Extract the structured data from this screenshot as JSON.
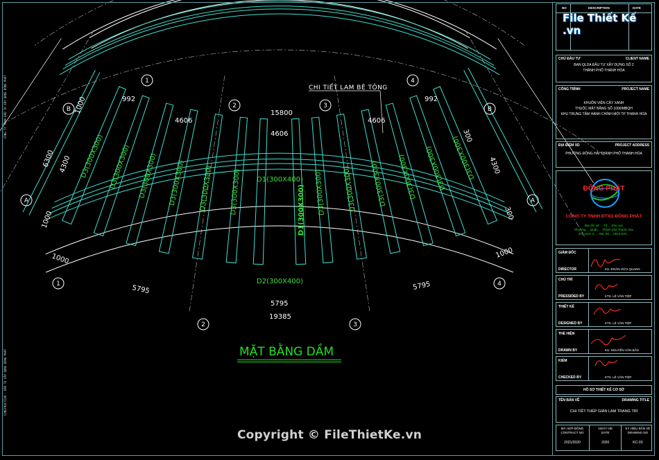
{
  "drawing": {
    "title": "MẶT BẰNG DẦM",
    "callout": "CHI TIẾT LAM BÊ TÔNG",
    "grid_labels": [
      "1",
      "2",
      "3",
      "4",
      "A",
      "B"
    ],
    "dimensions": {
      "d_15800": "15800",
      "d_4606_a": "4606",
      "d_4606_b": "4606",
      "d_4606_c": "4606",
      "d_992_a": "992",
      "d_992_b": "992",
      "d_1000_tl": "1000",
      "d_6300_l": "6300",
      "d_4300_l": "4300",
      "d_1000_l": "1000",
      "d_1000_bl": "1000",
      "d_5795_l": "5795",
      "d_5795_c": "5795",
      "d_5795_r": "5795",
      "d_19385": "19385",
      "d_300_r": "300",
      "d_4300_r": "4300",
      "d_300_rm": "300",
      "d_1000_br": "1000"
    },
    "beam_labels": {
      "d1": "D1(300X400)",
      "d2": "D2(300X400)",
      "d3": "D3(300X300)"
    },
    "highlight_label": "D1(300X300)"
  },
  "title_block": {
    "header_no": "NO",
    "header_description": "DESCRIPTION",
    "header_date": "DATE",
    "client_label": "CHỦ ĐẦU TƯ",
    "client_label_en": "CLIENT NAME",
    "client_line1": "BAN QLDA ĐẦU TƯ XÂY DỰNG SỐ 2",
    "client_line2": "THÀNH PHỐ THANH HÓA",
    "project_label": "CÔNG TRÌNH",
    "project_label_en": "PROJECT NAME",
    "project_line1": "KHUÔN VIÊN CÂY XANH",
    "project_line2": "THUỘC MẶT BẰNG SỐ 1000/MBQH",
    "project_line3": "KHU TRUNG TÂM HÀNH CHÍNH MỚI TP THANH HÓA",
    "location_label": "ĐỊA ĐIỂM XD",
    "location_label_en": "PROJECT ADDRESS",
    "location_line": "PHƯỜNG ĐÔNG HẢI THÀNH PHỐ THANH HÓA",
    "company_logo_text": "ĐÔNG PHÁT",
    "company_name": "CÔNG TY TNHH ĐTXD ĐÔNG PHÁT",
    "company_addr1": "Địa chỉ: số ... Tổ ... Khu vực",
    "company_addr2": "Phường ... Quận ... Thành phố Thanh Hóa",
    "company_addr3": "ĐT: 0237.3... - DĐ: 09..., 0913.979...",
    "roles": [
      {
        "vn": "GIÁM ĐỐC",
        "en": "DIRECTOR",
        "name": "KS. ĐOÀN HỮU QUANG"
      },
      {
        "vn": "CHỦ TRÌ",
        "en": "PRESSIDED BY",
        "name": "KTS. LÊ VĂN TIỆP"
      },
      {
        "vn": "THIẾT KẾ",
        "en": "DESIGNED BY",
        "name": "KTS. LÊ VĂN TIỆP"
      },
      {
        "vn": "THỂ HIỆN",
        "en": "DRAWN BY",
        "name": "KS. NGUYỄN VĂN BẢO"
      },
      {
        "vn": "KIỂM",
        "en": "CHECKED BY",
        "name": "KTS. LÊ VĂN TIỆP"
      }
    ],
    "stage": "HỒ SƠ THIẾT KẾ CƠ SỞ",
    "sheet_label": "TÊN BẢN VẼ",
    "sheet_label_en": "DRAWING TITLE",
    "sheet_title": "CHI TIẾT THÉP GIÀN LAM TRANG TRÍ",
    "bottom": [
      {
        "vn": "MÃ HỢP ĐỒNG",
        "en": "CONTRACT NO",
        "value": "2021/2020"
      },
      {
        "vn": "NGÀY HĐ",
        "en": "DATE",
        "value": "2020"
      },
      {
        "vn": "KÝ HIỆU BẢN VẼ",
        "en": "DRAWING NO",
        "value": "KC-03"
      }
    ]
  },
  "watermark": {
    "logo_text": "File Thiết Kế .vn",
    "copyright": "Copyright © FileThietKe.vn"
  },
  "colors": {
    "grid_line": "#ffffff",
    "beam": "#40e0d0",
    "beam_label": "#3ee03e",
    "dimension": "#ffffff",
    "border": "#5aa0a8",
    "company": "#ff2a2a",
    "signature": "#ff3030"
  }
}
